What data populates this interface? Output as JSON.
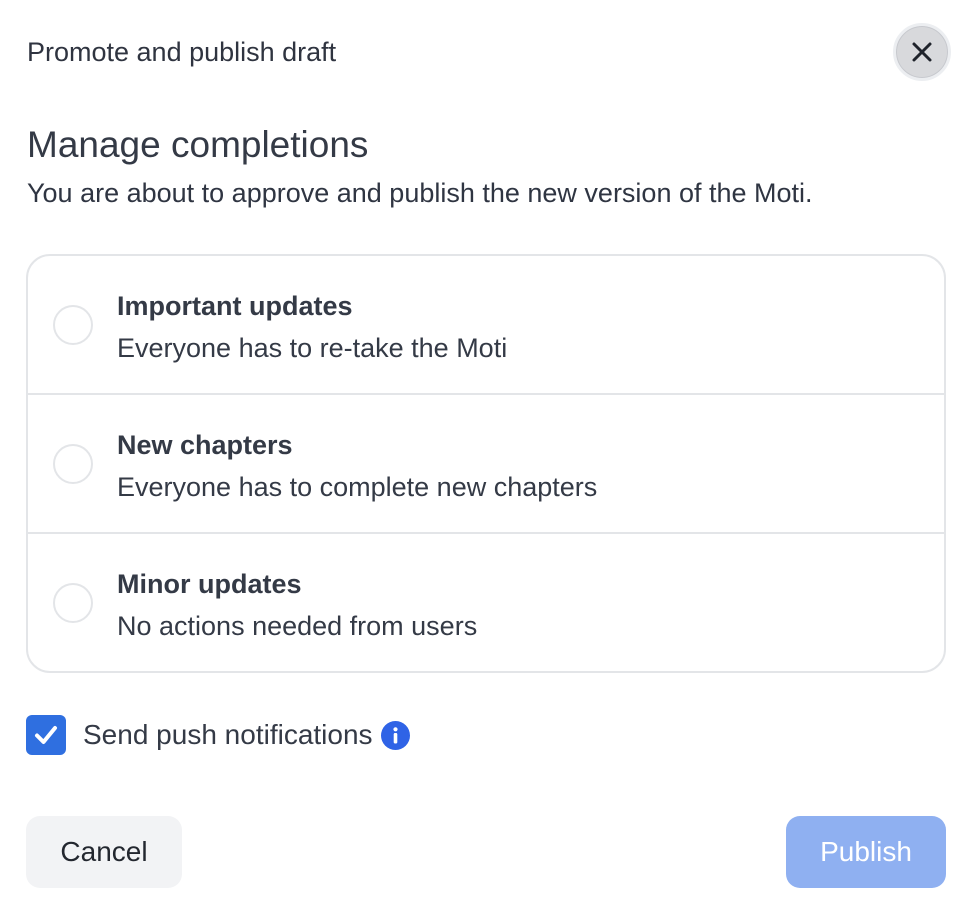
{
  "dialog": {
    "title": "Promote and publish draft",
    "close_icon": "close-icon"
  },
  "section": {
    "heading": "Manage completions",
    "description": "You are about to approve and publish the new version of the Moti."
  },
  "options": [
    {
      "title": "Important updates",
      "description": "Everyone has to re-take the Moti",
      "selected": false
    },
    {
      "title": "New chapters",
      "description": "Everyone has to complete new chapters",
      "selected": false
    },
    {
      "title": "Minor updates",
      "description": "No actions needed from users",
      "selected": false
    }
  ],
  "push": {
    "label": "Send push notifications",
    "checked": true,
    "info_icon": "info-icon"
  },
  "actions": {
    "cancel_label": "Cancel",
    "publish_label": "Publish"
  },
  "colors": {
    "accent": "#2f6fe0",
    "publish_disabled": "#8fb0f1",
    "cancel_bg": "#f2f3f5",
    "border": "#e3e5e8",
    "text": "#343a46"
  }
}
